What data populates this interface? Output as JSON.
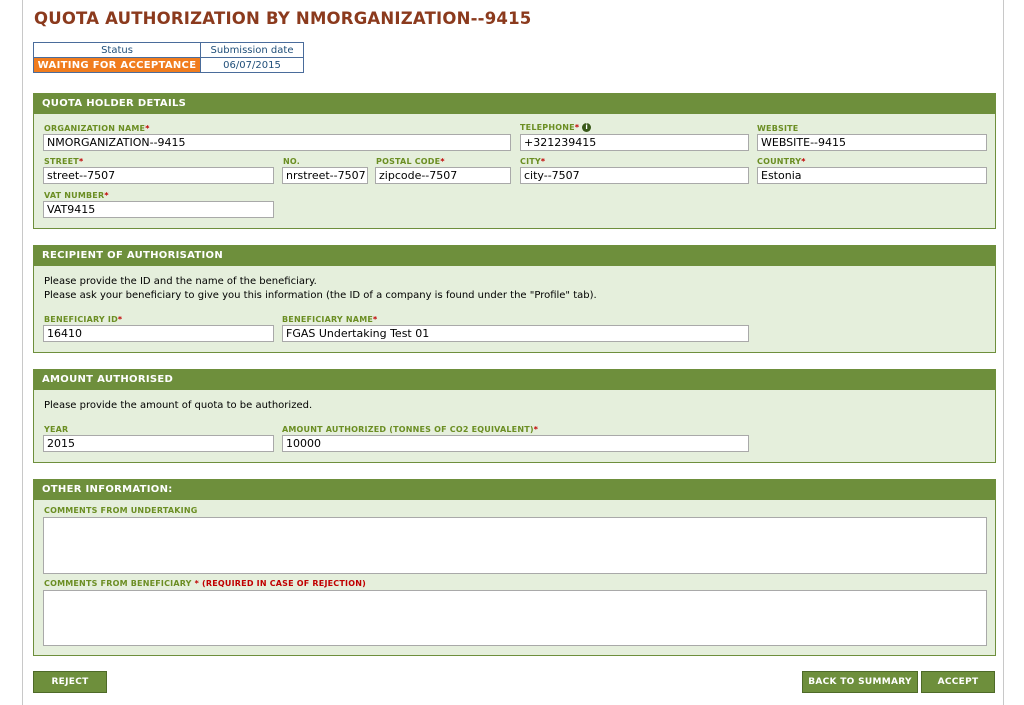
{
  "page": {
    "title": "QUOTA AUTHORIZATION BY NMORGANIZATION--9415"
  },
  "status_table": {
    "status_header": "Status",
    "date_header": "Submission date",
    "status_value": "WAITING FOR ACCEPTANCE",
    "date_value": "06/07/2015",
    "status_color": "#f07c1e"
  },
  "holder": {
    "title": "QUOTA HOLDER DETAILS",
    "org_label": "ORGANIZATION NAME",
    "org_value": "NMORGANIZATION--9415",
    "tel_label": "TELEPHONE",
    "tel_value": "+321239415",
    "web_label": "WEBSITE",
    "web_value": "WEBSITE--9415",
    "street_label": "STREET",
    "street_value": "street--7507",
    "no_label": "NO.",
    "no_value": "nrstreet--7507",
    "postal_label": "POSTAL CODE",
    "postal_value": "zipcode--7507",
    "city_label": "CITY",
    "city_value": "city--7507",
    "country_label": "COUNTRY",
    "country_value": "Estonia",
    "vat_label": "VAT NUMBER",
    "vat_value": "VAT9415",
    "required_mark": "*",
    "info_icon": "info-icon"
  },
  "recipient": {
    "title": "RECIPIENT OF AUTHORISATION",
    "line1": "Please provide the ID and the name of the beneficiary.",
    "line2": "Please ask your beneficiary to give you this information (the ID of a company is found under the \"Profile\" tab).",
    "id_label": "BENEFICIARY ID",
    "id_value": "16410",
    "name_label": "BENEFICIARY NAME",
    "name_value": "FGAS Undertaking Test 01"
  },
  "amount": {
    "title": "AMOUNT AUTHORISED",
    "line1": "Please provide the amount of quota to be authorized.",
    "year_label": "YEAR",
    "year_value": "2015",
    "amount_label": "AMOUNT AUTHORIZED (TONNES OF CO2 EQUIVALENT)",
    "amount_value": "10000"
  },
  "other": {
    "title": "OTHER INFORMATION:",
    "comments_undertaking_label": "COMMENTS FROM UNDERTAKING",
    "comments_beneficiary_label": "COMMENTS FROM BENEFICIARY",
    "comments_beneficiary_note": "(REQUIRED IN CASE OF REJECTION)",
    "comments_undertaking_value": "",
    "comments_beneficiary_value": ""
  },
  "actions": {
    "reject": "REJECT",
    "back": "BACK TO SUMMARY",
    "accept": "ACCEPT"
  },
  "colors": {
    "accent_green": "#6e8f3c",
    "panel_bg": "#e5efdc",
    "title_color": "#8b3a1d",
    "required_red": "#c00000"
  }
}
